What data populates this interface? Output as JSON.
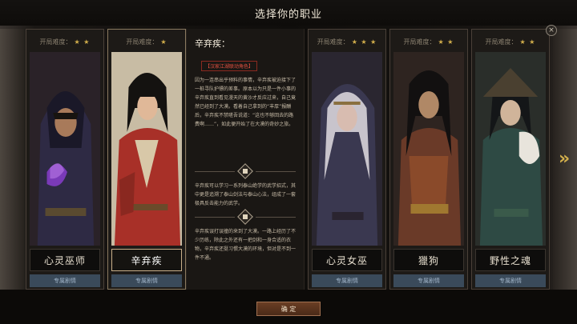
{
  "header": {
    "title": "选择你的职业"
  },
  "difficulty_label": "开局难度：",
  "cards": [
    {
      "name": "心灵巫师",
      "stars": "★ ★",
      "story": "专属剧情",
      "selected": false
    },
    {
      "name": "辛弃疾",
      "stars": "★",
      "story": "专属剧情",
      "selected": true
    },
    {
      "name": "心灵女巫",
      "stars": "★ ★ ★",
      "story": "专属剧情",
      "selected": false
    },
    {
      "name": "獵狗",
      "stars": "★ ★",
      "story": "专属剧情",
      "selected": false
    },
    {
      "name": "野性之魂",
      "stars": "★ ★",
      "story": "专属剧情",
      "selected": false
    }
  ],
  "description": {
    "name": "辛弃疾：",
    "tag": "【汉家江湖联动角色】",
    "paragraph1": "因为一连串出乎预料的事情，辛弃疾被迫接下了一桩寻队护镖的差事。原本以为只是一件小事的辛弃疾直到看见漫天的黄沙才反应过来，自己竟然已经到了大漠。看着自己拿到的“丰厚”报酬后，辛弃疾不禁嗟吾说道：“这也不够回去的路费啊……”，如此便开始了在大漠的奇妙之旅。",
    "paragraph2": "辛弃疾可以学习一系列泰山绝学的武学招式，其中更是追溯了泰山剑法与泰山心法，组成了一套极具反击能力的武学。",
    "paragraph3": "辛弃疾误打误撞的来到了大漠。一路上经历了不少历练，除此之外还有一把剑和一身合适的衣物，辛弃疾还挺习惯大漠的环境，但对是不到一件不通。"
  },
  "buttons": {
    "confirm": "确 定",
    "close": "×",
    "next": "»"
  },
  "colors": {
    "accent": "#d4b04c",
    "tag": "#e05040",
    "story_bar": "#3a4a5a"
  }
}
